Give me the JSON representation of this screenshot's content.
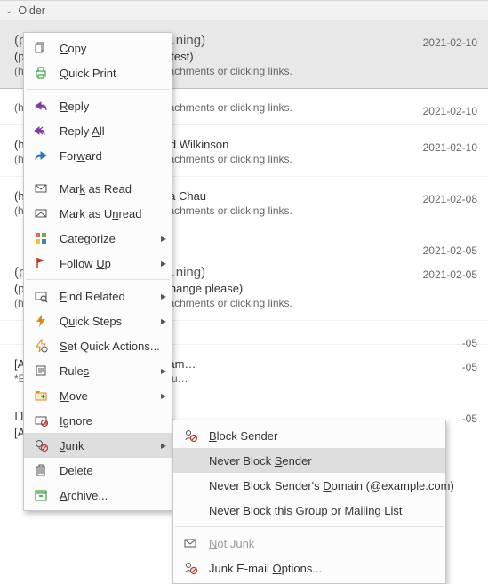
{
  "group_header": "Older",
  "emails": [
    {
      "from": "(partly hidden — ends in …ning)",
      "subject": "(partly hidden — ends in …rm test)",
      "preview": "(hidden) …tion when opening attachments or clicking links.",
      "date": "2021-02-10",
      "selected": true
    },
    {
      "from": "",
      "subject": "",
      "preview": "(hidden) …tion when opening attachments or clicking links.",
      "date": "2021-02-10"
    },
    {
      "from": "",
      "subject": "(hidden) …uirement for Richard Wilkinson",
      "preview": "(hidden) …tion when opening attachments or clicking links.",
      "date": "2021-02-10"
    },
    {
      "from": "",
      "subject": "(hidden) …uirement for Melissa Chau",
      "preview": "(hidden) …tion when opening attachments or clicking links.",
      "date": "2021-02-08"
    },
    {
      "from": "",
      "subject": "",
      "preview": "",
      "date": "2021-02-05"
    },
    {
      "from": "(partly hidden — ends in …ning)",
      "subject": "(partly hidden — ends in …n change please)",
      "preview": "(hidden) …tion when opening attachments or clicking links.",
      "date": "2021-02-05"
    },
    {
      "from": "",
      "subject": "",
      "preview": "",
      "date": "-05"
    },
    {
      "from": "",
      "subject": "[Atlantic Packaging] Re: Program…",
      "preview": "*EXTERNAL EMAIL* Exercise cau…",
      "date": "-05"
    },
    {
      "from": "IT Coop (Atlantic Packag…",
      "subject": "[Atlantic Packaging] Re: Program…",
      "preview": "",
      "date": "-05"
    }
  ],
  "context_menu": [
    {
      "icon": "copy",
      "label": "Copy",
      "mnemonic": "C"
    },
    {
      "icon": "print",
      "label": "Quick Print",
      "mnemonic": "Q"
    },
    {
      "sep": true
    },
    {
      "icon": "reply",
      "label": "Reply",
      "mnemonic": "R"
    },
    {
      "icon": "replyall",
      "label": "Reply All",
      "mnemonic": "A"
    },
    {
      "icon": "forward",
      "label": "Forward",
      "mnemonic": "w"
    },
    {
      "sep": true
    },
    {
      "icon": "read",
      "label": "Mark as Read",
      "mnemonic": "k"
    },
    {
      "icon": "unread",
      "label": "Mark as Unread",
      "mnemonic": "n"
    },
    {
      "icon": "categorize",
      "label": "Categorize",
      "mnemonic": "e",
      "arrow": true
    },
    {
      "icon": "flag",
      "label": "Follow Up",
      "mnemonic": "U",
      "arrow": true
    },
    {
      "sep": true
    },
    {
      "icon": "find",
      "label": "Find Related",
      "mnemonic": "F",
      "arrow": true
    },
    {
      "icon": "quicksteps",
      "label": "Quick Steps",
      "mnemonic": "u",
      "arrow": true
    },
    {
      "icon": "quickactions",
      "label": "Set Quick Actions...",
      "mnemonic": "S"
    },
    {
      "icon": "rules",
      "label": "Rules",
      "mnemonic": "s",
      "arrow": true
    },
    {
      "icon": "move",
      "label": "Move",
      "mnemonic": "M",
      "arrow": true
    },
    {
      "icon": "ignore",
      "label": "Ignore",
      "mnemonic": "I"
    },
    {
      "icon": "junk",
      "label": "Junk",
      "mnemonic": "J",
      "arrow": true,
      "highlight": true
    },
    {
      "icon": "delete",
      "label": "Delete",
      "mnemonic": "D"
    },
    {
      "icon": "archive",
      "label": "Archive...",
      "mnemonic": "A"
    }
  ],
  "junk_submenu": [
    {
      "icon": "block",
      "label": "Block Sender",
      "mnemonic": "B"
    },
    {
      "icon": "",
      "label": "Never Block Sender",
      "mnemonic": "S",
      "highlight": true
    },
    {
      "icon": "",
      "label": "Never Block Sender's Domain (@example.com)",
      "mnemonic": "D"
    },
    {
      "icon": "",
      "label": "Never Block this Group or Mailing List",
      "mnemonic": "M"
    },
    {
      "sep": true
    },
    {
      "icon": "notjunk",
      "label": "Not Junk",
      "mnemonic": "N",
      "disabled": true
    },
    {
      "icon": "options",
      "label": "Junk E-mail Options...",
      "mnemonic": "O"
    }
  ]
}
